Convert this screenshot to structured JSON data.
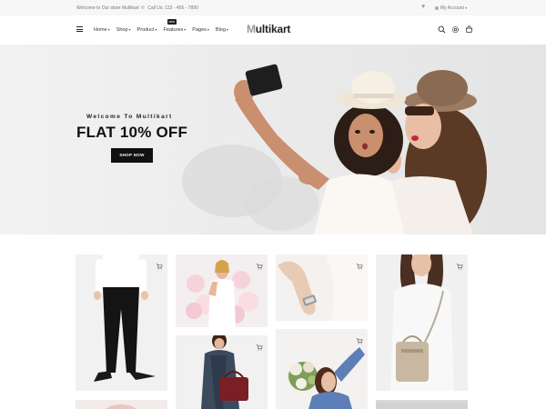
{
  "topbar": {
    "welcome": "Welcome to Our store Multikart",
    "call": "Call Us: 123 - 456 - 7890",
    "account": "My Account"
  },
  "nav": {
    "items": [
      {
        "label": "Home"
      },
      {
        "label": "Shop"
      },
      {
        "label": "Product"
      },
      {
        "label": "Features",
        "badge": "new"
      },
      {
        "label": "Pages"
      },
      {
        "label": "Blog"
      }
    ]
  },
  "logo": {
    "mark": "M",
    "rest": "ultikart"
  },
  "hero": {
    "welcome": "Welcome To Multikart",
    "headline": "FLAT 10% OFF",
    "button": "shop now"
  },
  "icons": {
    "search": "search-icon",
    "settings": "gear-icon",
    "cart": "cart-icon",
    "wishlist": "heart-icon",
    "account": "user-icon",
    "phone": "phone-icon",
    "menu": "hamburger-icon"
  },
  "colors": {
    "accent": "#111111",
    "background": "#ffffff",
    "topbar": "#f7f7f7",
    "hero_bg": "#ebebeb"
  }
}
